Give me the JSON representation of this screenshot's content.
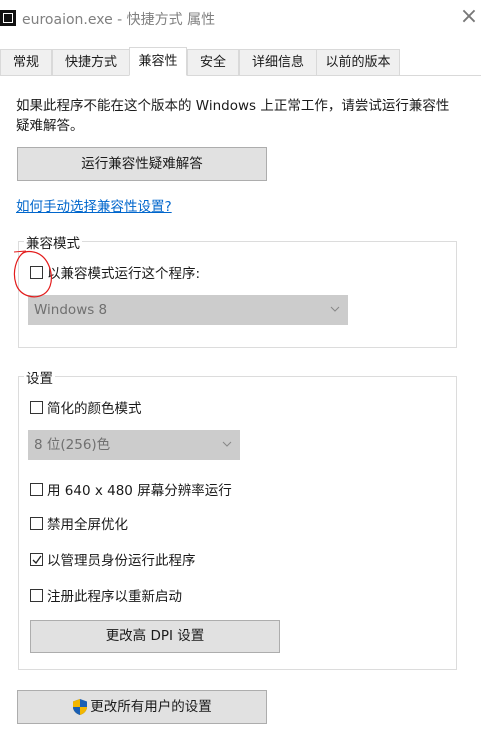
{
  "window": {
    "title": "euroaion.exe - 快捷方式 属性"
  },
  "tabs": [
    {
      "label": "常规"
    },
    {
      "label": "快捷方式"
    },
    {
      "label": "兼容性"
    },
    {
      "label": "安全"
    },
    {
      "label": "详细信息"
    },
    {
      "label": "以前的版本"
    }
  ],
  "active_tab": "兼容性",
  "compat": {
    "description": "如果此程序不能在这个版本的 Windows 上正常工作，请尝试运行兼容性疑难解答。",
    "troubleshoot_button": "运行兼容性疑难解答",
    "manual_link": "如何手动选择兼容性设置?",
    "mode_group_title": "兼容模式",
    "mode_checkbox_label": "以兼容模式运行这个程序:",
    "mode_checked": false,
    "mode_select_value": "Windows 8"
  },
  "settings": {
    "group_title": "设置",
    "reduced_color_label": "简化的颜色模式",
    "reduced_color_checked": false,
    "color_select_value": "8 位(256)色",
    "res_640_label": "用 640 x 480 屏幕分辨率运行",
    "res_640_checked": false,
    "disable_fullscreen_label": "禁用全屏优化",
    "disable_fullscreen_checked": false,
    "run_as_admin_label": "以管理员身份运行此程序",
    "run_as_admin_checked": true,
    "register_restart_label": "注册此程序以重新启动",
    "register_restart_checked": false,
    "dpi_button": "更改高 DPI 设置"
  },
  "all_users_button": "更改所有用户的设置",
  "colors": {
    "link": "#0066cc",
    "annotation": "#e31c1c",
    "shield_blue": "#1a5fb4",
    "shield_gold": "#f2b600"
  }
}
